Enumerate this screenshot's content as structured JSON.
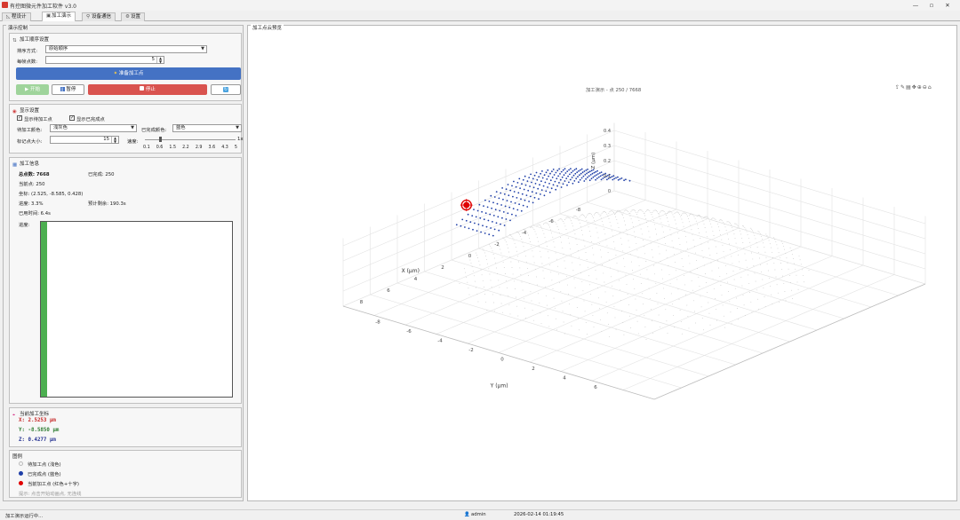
{
  "window": {
    "title": "有控图微元件加工软件 v3.0",
    "minimize": "—",
    "maximize": "▫",
    "close": "✕"
  },
  "tabs": [
    {
      "label": "程设计",
      "icon": "chart-icon"
    },
    {
      "label": "加工演示",
      "icon": "gear-icon"
    },
    {
      "label": "设备通信",
      "icon": "plug-icon"
    },
    {
      "label": "设置",
      "icon": "settings-icon"
    }
  ],
  "left_group_title": "演示控制",
  "sequence": {
    "title": "加工顺序设置",
    "sort_label": "排序方式:",
    "sort_value": "原始顺序",
    "points_label": "每帧点数:",
    "points_value": "5",
    "prepare_button": "准备加工点",
    "start_button": "开始",
    "pause_button": "暂停",
    "stop_button": "停止"
  },
  "display": {
    "title": "显示设置",
    "show_pending_label": "显示待加工点",
    "show_done_label": "显示已完成点",
    "pending_color_label": "待加工颜色:",
    "pending_color_value": "浅灰色",
    "done_color_label": "已完成颜色:",
    "done_color_value": "蓝色",
    "marker_size_label": "标记点大小:",
    "marker_size_value": "15",
    "speed_label": "速度:",
    "speed_value": "1x",
    "speed_ticks": [
      "0.1",
      "0.6",
      "1.5",
      "2.2",
      "2.9",
      "3.6",
      "4.3",
      "5"
    ]
  },
  "info": {
    "title": "加工信息",
    "total_label": "总点数: 7668",
    "done_label": "已完成: 250",
    "current_label": "当前点: 250",
    "coords_label": "坐标: (2.525, -8.585, 0.428)",
    "progress_label": "进度: 3.3%",
    "remaining_label": "预计剩余: 190.3s",
    "elapsed_label": "已用时间: 6.4s",
    "progress_area_label": "进度:",
    "progress_fraction": 0.033
  },
  "coords": {
    "title": "当前加工坐标",
    "x": "X: 2.5253 μm",
    "y": "Y: -8.5850 μm",
    "z": "Z: 0.4277 μm"
  },
  "legend": {
    "title": "图例",
    "pending": "待加工点 (浅色)",
    "done": "已完成点 (蓝色)",
    "current": "当前加工点 (红色+十字)",
    "hint": "提示: 点击开始动画点, 无连线"
  },
  "plot": {
    "group_title": "加工点云预览",
    "title": "加工演示 - 点 250 / 7668",
    "xlabel": "X (μm)",
    "ylabel": "Y (μm)",
    "zlabel": "Z (μm)",
    "x_ticks": [
      "-8",
      "-6",
      "-4",
      "-2",
      "0",
      "2",
      "4",
      "6",
      "8"
    ],
    "y_ticks": [
      "-8",
      "-6",
      "-4",
      "-2",
      "0",
      "2",
      "4",
      "6"
    ],
    "z_ticks": [
      "0.4",
      "0.3",
      "0.2",
      "0.1",
      "0"
    ],
    "toolbar_icons": [
      "export-icon",
      "brush-icon",
      "datatip-icon",
      "pan-icon",
      "zoom-in-icon",
      "zoom-out-icon",
      "home-icon"
    ],
    "colors": {
      "done": "#1f3fa8",
      "pending": "#c8c8c8",
      "current": "#e00000",
      "grid": "#e2e2e2"
    }
  },
  "status": {
    "message": "加工演示运行中...",
    "user": "admin",
    "datetime": "2026-02-14 01:19:45"
  }
}
